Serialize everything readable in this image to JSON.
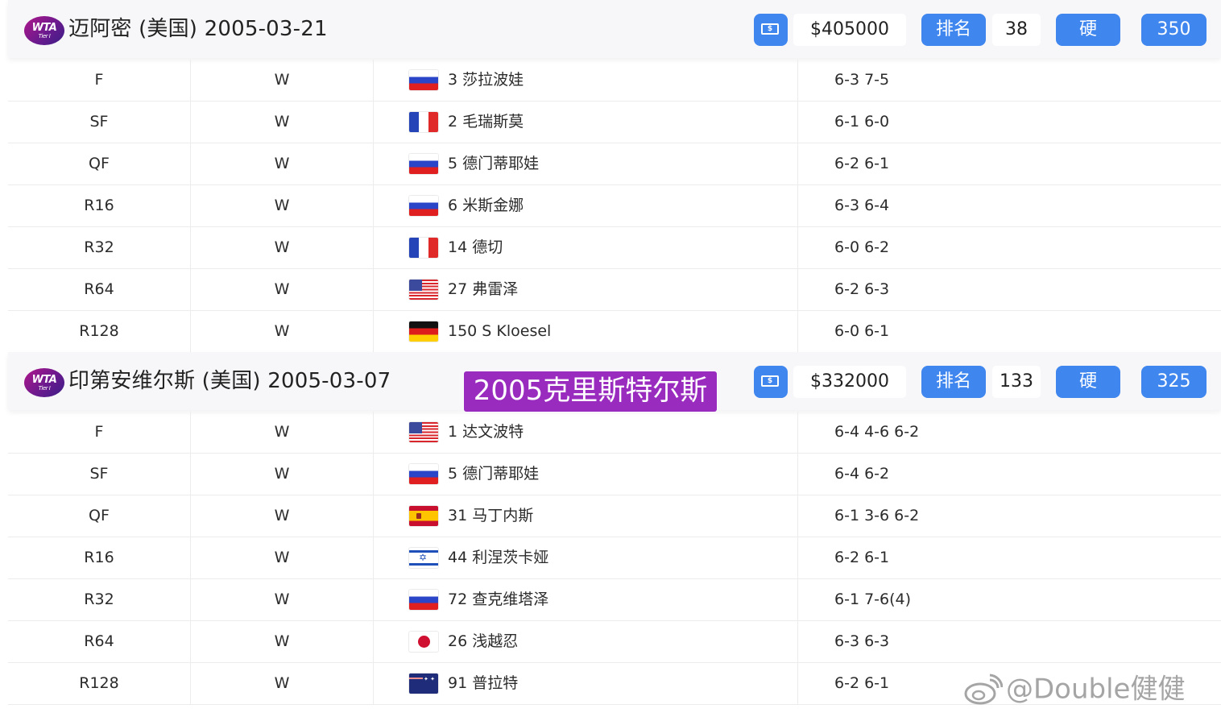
{
  "tournaments": [
    {
      "logo_text": "WTA",
      "logo_tier": "Tier I",
      "title": "迈阿密 (美国) 2005-03-21",
      "prize": "$405000",
      "rank_label": "排名",
      "rank_value": "38",
      "surface": "硬",
      "points": "350",
      "matches": [
        {
          "round": "F",
          "result": "W",
          "flag": "ru",
          "opponent": "3 莎拉波娃",
          "score": "6-3 7-5"
        },
        {
          "round": "SF",
          "result": "W",
          "flag": "fr",
          "opponent": "2 毛瑞斯莫",
          "score": "6-1 6-0"
        },
        {
          "round": "QF",
          "result": "W",
          "flag": "ru",
          "opponent": "5 德门蒂耶娃",
          "score": "6-2 6-1"
        },
        {
          "round": "R16",
          "result": "W",
          "flag": "ru",
          "opponent": "6 米斯金娜",
          "score": "6-3 6-4"
        },
        {
          "round": "R32",
          "result": "W",
          "flag": "fr",
          "opponent": "14 德切",
          "score": "6-0 6-2"
        },
        {
          "round": "R64",
          "result": "W",
          "flag": "us",
          "opponent": "27 弗雷泽",
          "score": "6-2 6-3"
        },
        {
          "round": "R128",
          "result": "W",
          "flag": "de",
          "opponent": "150 S Kloesel",
          "score": "6-0 6-1"
        }
      ]
    },
    {
      "logo_text": "WTA",
      "logo_tier": "Tier I",
      "title": "印第安维尔斯 (美国) 2005-03-07",
      "prize": "$332000",
      "rank_label": "排名",
      "rank_value": "133",
      "surface": "硬",
      "points": "325",
      "matches": [
        {
          "round": "F",
          "result": "W",
          "flag": "us",
          "opponent": "1 达文波特",
          "score": "6-4 4-6 6-2"
        },
        {
          "round": "SF",
          "result": "W",
          "flag": "ru",
          "opponent": "5 德门蒂耶娃",
          "score": "6-4 6-2"
        },
        {
          "round": "QF",
          "result": "W",
          "flag": "es",
          "opponent": "31 马丁内斯",
          "score": "6-1 3-6 6-2"
        },
        {
          "round": "R16",
          "result": "W",
          "flag": "il",
          "opponent": "44 利涅茨卡娅",
          "score": "6-2 6-1"
        },
        {
          "round": "R32",
          "result": "W",
          "flag": "ru",
          "opponent": "72 查克维塔泽",
          "score": "6-1 7-6(4)"
        },
        {
          "round": "R64",
          "result": "W",
          "flag": "jp",
          "opponent": "26 浅越忍",
          "score": "6-3 6-3"
        },
        {
          "round": "R128",
          "result": "W",
          "flag": "au",
          "opponent": "91 普拉特",
          "score": "6-2 6-1"
        }
      ]
    }
  ],
  "overlay_caption": "2005克里斯特尔斯",
  "watermark": "@Double健健",
  "icons": {
    "prize": "money-icon",
    "weibo": "weibo-icon"
  },
  "colors": {
    "accent": "#3f86ef",
    "caption_bg": "#9a2bbf",
    "logo_purple": "#6b1a8e"
  }
}
